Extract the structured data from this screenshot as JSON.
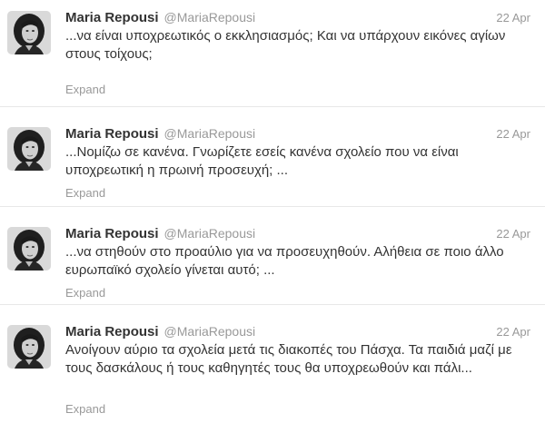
{
  "tweets": [
    {
      "name": "Maria Repousi",
      "handle": "@MariaRepousi",
      "time": "22 Apr",
      "text": "...να είναι υποχρεωτικός ο εκκλησιασμός; Και να υπάρχουν εικόνες αγίων στους τοίχους;",
      "expand": "Expand"
    },
    {
      "name": "Maria Repousi",
      "handle": "@MariaRepousi",
      "time": "22 Apr",
      "text": "...Νομίζω σε κανένα. Γνωρίζετε εσείς κανένα σχολείο που να είναι υποχρεωτική η πρωινή προσευχή; ...",
      "expand": "Expand"
    },
    {
      "name": "Maria Repousi",
      "handle": "@MariaRepousi",
      "time": "22 Apr",
      "text": "...να στηθούν στο προαύλιο για να προσευχηθούν. Αλήθεια σε ποιο άλλο ευρωπαϊκό σχολείο γίνεται αυτό; ...",
      "expand": "Expand"
    },
    {
      "name": "Maria Repousi",
      "handle": "@MariaRepousi",
      "time": "22 Apr",
      "text": "Ανοίγουν αύριο τα σχολεία μετά τις διακοπές του Πάσχα. Τα παιδιά μαζί με τους δασκάλους ή τους καθηγητές τους θα υποχρεωθούν και πάλι...",
      "expand": "Expand"
    }
  ]
}
